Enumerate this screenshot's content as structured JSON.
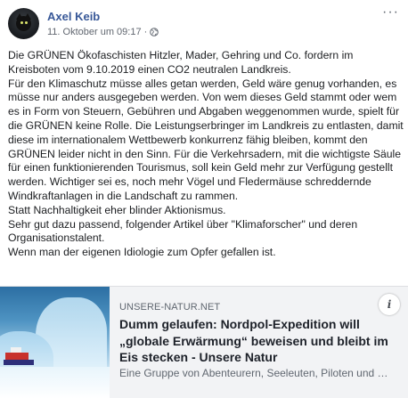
{
  "post": {
    "author": "Axel Keib",
    "timestamp": "11. Oktober um 09:17",
    "separator": "·",
    "privacy_icon": "globe-icon",
    "more_icon": "···",
    "paragraphs": [
      "Die GRÜNEN Ökofaschisten Hitzler, Mader, Gehring und Co. fordern im Kreisboten vom 9.10.2019 einen CO2 neutralen Landkreis.",
      "Für den Klimaschutz müsse alles getan werden, Geld wäre genug vorhanden, es müsse nur anders ausgegeben werden. Von wem dieses Geld stammt oder wem es in Form von Steuern, Gebühren und Abgaben weggenommen wurde, spielt für die GRÜNEN keine Rolle. Die Leistungserbringer im Landkreis zu entlasten, damit diese im internationalem Wettbewerb konkurrenz fähig bleiben, kommt den GRÜNEN leider nicht in den Sinn. Für die Verkehrsadern, mit die wichtigste Säule für einen funktionierenden Tourismus, soll kein Geld mehr zur Verfügung gestellt werden. Wichtiger sei es, noch mehr Vögel und Fledermäuse schreddernde Windkraftanlagen in die Landschaft zu rammen.",
      "Statt Nachhaltigkeit eher blinder Aktionismus.",
      "Sehr gut dazu passend, folgender Artikel über \"Klimaforscher\" und deren Organisationstalent.",
      "Wenn man der eigenen Idiologie zum Opfer gefallen ist."
    ]
  },
  "link_card": {
    "domain": "UNSERE-NATUR.NET",
    "title": "Dumm gelaufen: Nordpol-Expedition will „globale Erwärmung“ beweisen und bleibt im Eis stecken - Unsere Natur",
    "description": "Eine Gruppe von Abenteurern, Seeleuten, Piloten und Wissenschaftlern",
    "info_icon": "i"
  },
  "colors": {
    "author_link": "#385898",
    "meta_text": "#616770",
    "card_background": "#f2f3f5"
  }
}
